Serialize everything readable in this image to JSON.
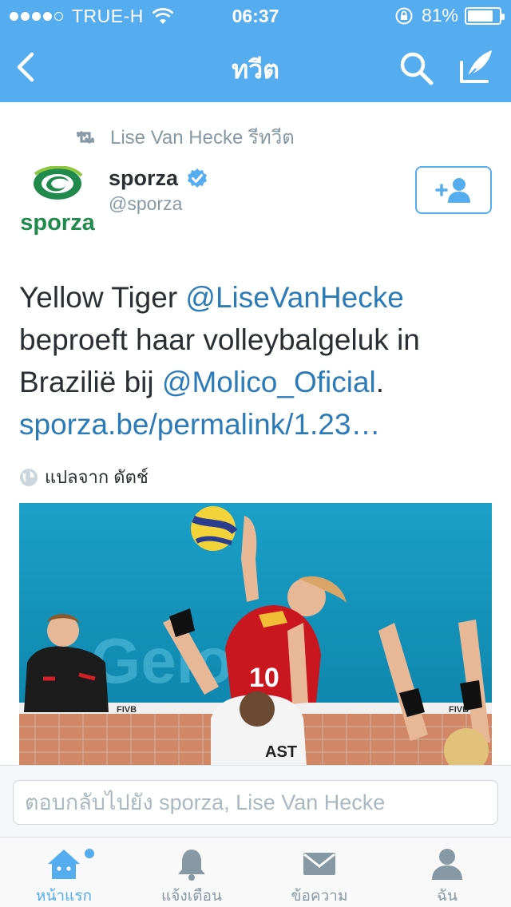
{
  "status_bar": {
    "signal_bars_filled": 4,
    "signal_bars_total": 5,
    "carrier": "TRUE-H",
    "time": "06:37",
    "battery_percent_text": "81%",
    "battery_level": 0.81
  },
  "nav": {
    "title": "ทวีต",
    "back_icon": "chevron-left-icon",
    "search_icon": "search-icon",
    "compose_icon": "compose-quill-icon"
  },
  "retweet": {
    "icon": "retweet-icon",
    "text": "Lise Van Hecke รีทวีต"
  },
  "author": {
    "name": "sporza",
    "handle": "@sporza",
    "verified_icon": "verified-badge-icon",
    "avatar_text": "sporza"
  },
  "tweet": {
    "text_1": "Yellow Tiger ",
    "mention_1": "@LiseVanHecke",
    "text_2": " beproeft haar volleybalgeluk in Brazilië bij ",
    "mention_2": "@Molico_Oficial",
    "text_3": ". ",
    "link": "sporza.be/permalink/1.23…"
  },
  "translate": {
    "icon": "globe-icon",
    "label": "แปลจาก ดัตช์"
  },
  "photo": {
    "banner_text_1": "FIVB",
    "banner_text_2": "FIVB",
    "jersey_number": "10",
    "jersey_name": "AST"
  },
  "reply": {
    "placeholder": "ตอบกลับไปยัง sporza, Lise Van Hecke"
  },
  "tabs": [
    {
      "label": "หน้าแรก",
      "icon": "home-icon",
      "active": true,
      "has_badge": true
    },
    {
      "label": "แจ้งเตือน",
      "icon": "bell-icon",
      "active": false
    },
    {
      "label": "ข้อความ",
      "icon": "envelope-icon",
      "active": false
    },
    {
      "label": "ฉัน",
      "icon": "person-icon",
      "active": false
    }
  ],
  "colors": {
    "brand_blue": "#55acee",
    "link_blue": "#2b7bb9",
    "gray_text": "#8899a6",
    "sporza_green": "#1f8a4c"
  }
}
